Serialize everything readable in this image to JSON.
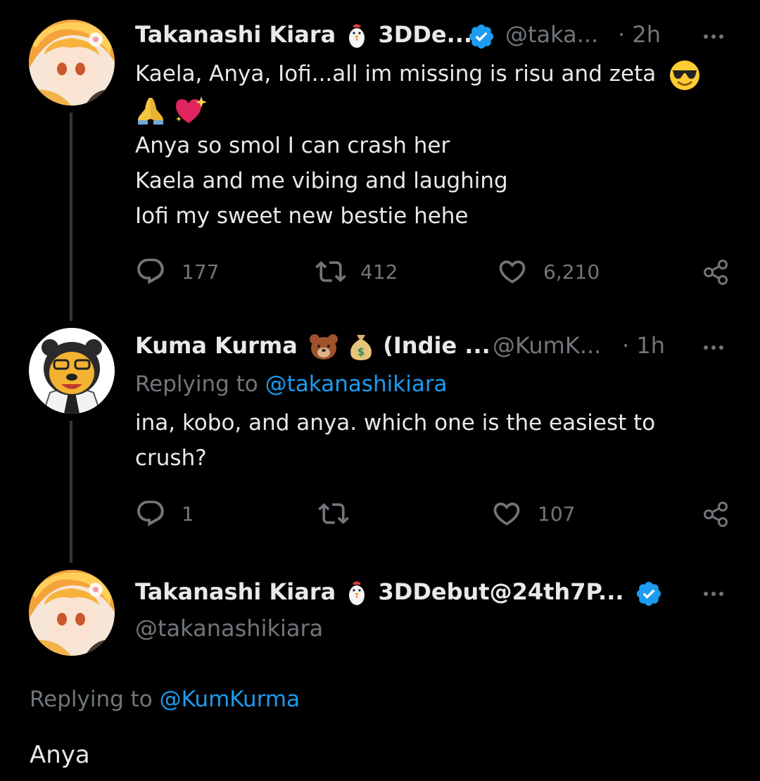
{
  "tweet1": {
    "name": "Takanashi Kiara",
    "name_suffix": "3DDe...",
    "handle": "@taka...",
    "time": "· 2h",
    "lines": [
      "Kaela, Anya, Iofi...all im missing is risu and zeta",
      "Anya so smol I can crash her",
      "Kaela and me vibing and laughing",
      "Iofi my sweet new bestie hehe"
    ],
    "replies": "177",
    "retweets": "412",
    "likes": "6,210"
  },
  "tweet2": {
    "name": "Kuma Kurma",
    "name_suffix": "(Indie ...",
    "handle": "@KumK...",
    "time": "· 1h",
    "replying_label": "Replying to",
    "replying_to": "@takanashikiara",
    "lines": [
      "ina, kobo, and anya. which one is the easiest to",
      "crush?"
    ],
    "replies": "1",
    "likes": "107"
  },
  "tweet3": {
    "name": "Takanashi Kiara",
    "name_suffix": "3DDebut@24th7P...",
    "handle": "@takanashikiara",
    "replying_label": "Replying to",
    "replying_to": "@KumKurma",
    "text": "Anya"
  },
  "colors": {
    "link": "#1d9bf0",
    "verified": "#1d9bf0",
    "muted": "#71767b",
    "text": "#e7e9ea"
  },
  "icons": [
    "chicken-emoji",
    "verified-badge-icon",
    "sunglasses-emoji",
    "folded-hands-emoji",
    "sparkling-heart-emoji",
    "bear-emoji",
    "money-bag-emoji",
    "reply-icon",
    "retweet-icon",
    "like-icon",
    "share-icon",
    "more-icon"
  ]
}
